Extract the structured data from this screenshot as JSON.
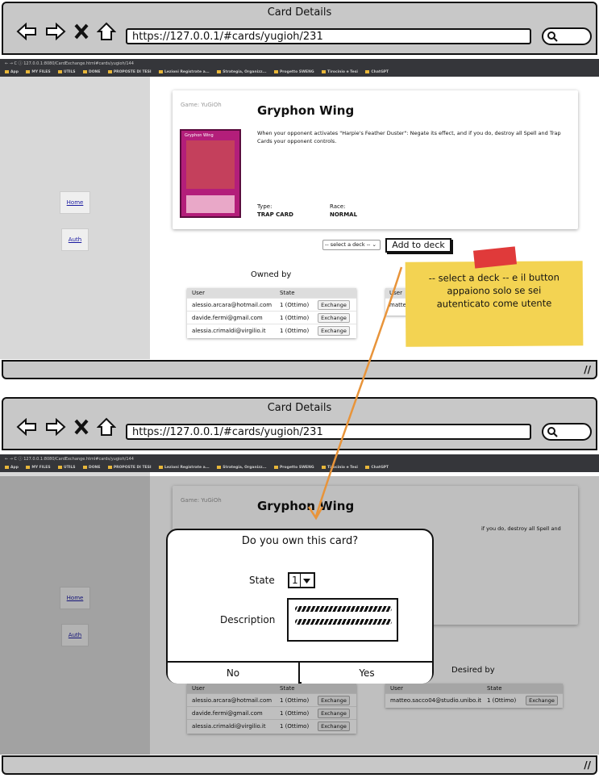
{
  "screen1": {
    "window_title": "Card Details",
    "url": "https://127.0.0.1/#cards/yugioh/231",
    "chrome_url": "127.0.0.1:8080/CardExchange.html#cards/yugioh/144",
    "bookmarks": [
      "App",
      "MY FILES",
      "UTILS",
      "DONE",
      "PROPOSTE DI TESI",
      "Lezioni Registrate a...",
      "Strategia, Organizz...",
      "Progetto SWENG",
      "Tirocinio e Tesi",
      "ChatGPT"
    ],
    "sidebar": {
      "home": "Home",
      "auth": "Auth"
    },
    "card": {
      "game_label": "Game: YuGiOh",
      "title": "Gryphon Wing",
      "image_name": "Gryphon Wing",
      "description": "When your opponent activates \"Harpie's Feather Duster\": Negate its effect, and if you do, destroy all Spell and Trap Cards your opponent controls.",
      "type_label": "Type:",
      "type_value": "TRAP CARD",
      "race_label": "Race:",
      "race_value": "NORMAL"
    },
    "deck_select": "-- select a deck --",
    "add_to_deck": "Add to deck",
    "owned_by": {
      "title": "Owned by",
      "headers": [
        "User",
        "State"
      ],
      "rows": [
        {
          "user": "alessio.arcara@hotmail.com",
          "state": "1 (Ottimo)",
          "action": "Exchange"
        },
        {
          "user": "davide.fermi@gmail.com",
          "state": "1 (Ottimo)",
          "action": "Exchange"
        },
        {
          "user": "alessia.crimaldi@virgilio.it",
          "state": "1 (Ottimo)",
          "action": "Exchange"
        }
      ]
    },
    "desired_partial": {
      "header_user": "User",
      "row_user": "matte"
    }
  },
  "note": {
    "text": "-- select a deck -- e il button appaiono solo se sei autenticato come utente"
  },
  "screen2": {
    "window_title": "Card Details",
    "url": "https://127.0.0.1/#cards/yugioh/231",
    "sidebar": {
      "home": "Home",
      "auth": "Auth"
    },
    "card": {
      "game_label": "Game: YuGiOh",
      "title": "Gryphon Wing",
      "desc_partial": "if you do, destroy all Spell and"
    },
    "modal": {
      "title": "Do you own this card?",
      "state_label": "State",
      "state_value": "1",
      "description_label": "Description",
      "no": "No",
      "yes": "Yes"
    },
    "owned_by": {
      "headers": [
        "User",
        "State"
      ],
      "rows": [
        {
          "user": "alessio.arcara@hotmail.com",
          "state": "1 (Ottimo)",
          "action": "Exchange"
        },
        {
          "user": "davide.fermi@gmail.com",
          "state": "1 (Ottimo)",
          "action": "Exchange"
        },
        {
          "user": "alessia.crimaldi@virgilio.it",
          "state": "1 (Ottimo)",
          "action": "Exchange"
        }
      ]
    },
    "desired_by": {
      "title": "Desired by",
      "headers": [
        "User",
        "State"
      ],
      "rows": [
        {
          "user": "matteo.sacco04@studio.unibo.it",
          "state": "1 (Ottimo)",
          "action": "Exchange"
        }
      ]
    }
  },
  "colors": {
    "note": "#f3d352",
    "tape": "#e03a3a",
    "arrow": "#e8943a",
    "frame": "#c8c8c8"
  }
}
